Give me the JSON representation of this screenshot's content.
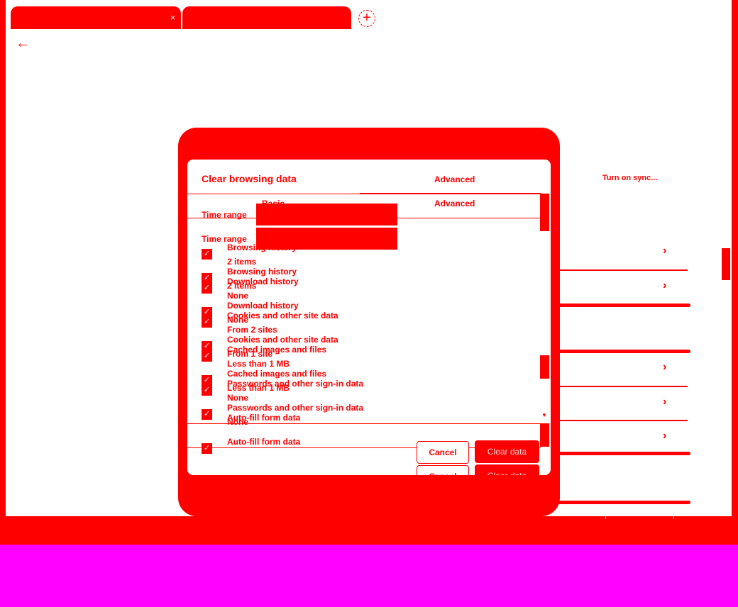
{
  "browser": {
    "tabs": [
      {
        "title": "",
        "close": "×"
      },
      {
        "title": ""
      }
    ],
    "new_tab": "+",
    "back": "←"
  },
  "settings": {
    "sync_button": "Turn on sync...",
    "chevron": "›"
  },
  "dialog": {
    "title": "Clear browsing data",
    "tabs": {
      "basic": "Basic",
      "advanced": "Advanced"
    },
    "time_range_label": "Time range",
    "time_range_value": "",
    "items": [
      {
        "title": "Browsing history",
        "detail": "2 items",
        "checked": true
      },
      {
        "title": "Download history",
        "detail": "None",
        "checked": true
      },
      {
        "title": "Cookies and other site data",
        "detail": "From 2 sites",
        "checked": true
      },
      {
        "title": "Cached images and files",
        "detail": "Less than 1 MB",
        "checked": true
      },
      {
        "title": "Passwords and other sign-in data",
        "detail": "None",
        "checked": true
      },
      {
        "title": "Auto-fill form data",
        "detail": "",
        "checked": true
      }
    ],
    "items_shifted": [
      {
        "title": "Browsing history",
        "detail": "2 items"
      },
      {
        "title": "Download history",
        "detail": "None"
      },
      {
        "title": "Cookies and other site data",
        "detail": "From 1 site"
      },
      {
        "title": "Cached images and files",
        "detail": "Less than 1 MB"
      },
      {
        "title": "Passwords and other sign-in data",
        "detail": "None"
      },
      {
        "title": "Auto-fill form data",
        "detail": ""
      }
    ],
    "cancel": "Cancel",
    "clear": "Clear data"
  },
  "colors": {
    "accent": "#ff0000",
    "background": "#ff00ff"
  }
}
